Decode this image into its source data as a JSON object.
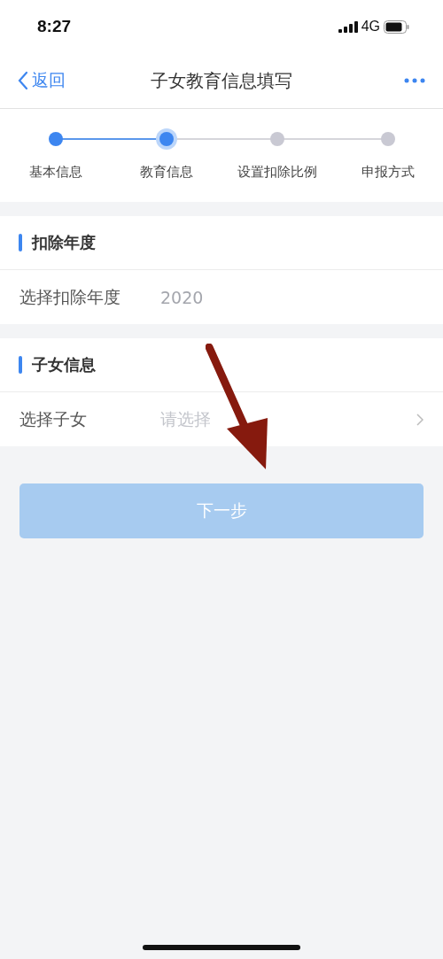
{
  "status_bar": {
    "time": "8:27",
    "network": "4G"
  },
  "nav": {
    "back": "返回",
    "title": "子女教育信息填写"
  },
  "steps": [
    {
      "label": "基本信息",
      "done": true,
      "selected": false
    },
    {
      "label": "教育信息",
      "done": true,
      "selected": true
    },
    {
      "label": "设置扣除比例",
      "done": false,
      "selected": false
    },
    {
      "label": "申报方式",
      "done": false,
      "selected": false
    }
  ],
  "sections": [
    {
      "title": "扣除年度",
      "row": {
        "label": "选择扣除年度",
        "value": "2020",
        "has_chevron": false
      }
    },
    {
      "title": "子女信息",
      "row": {
        "label": "选择子女",
        "placeholder": "请选择",
        "has_chevron": true
      }
    }
  ],
  "next_button": {
    "label": "下一步",
    "disabled": true
  }
}
